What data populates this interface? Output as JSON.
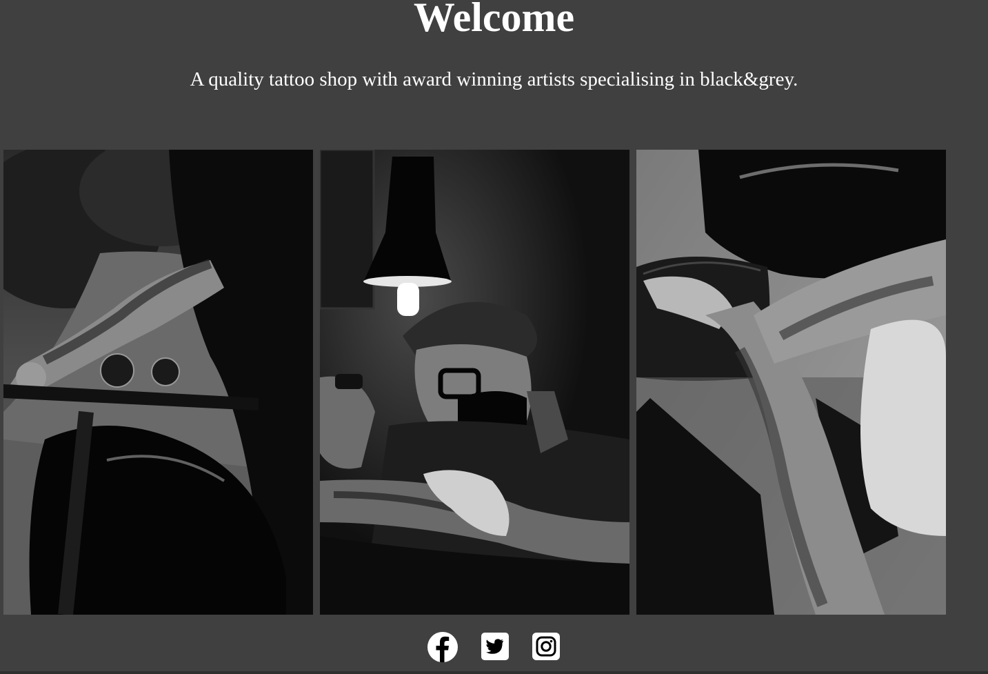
{
  "header": {
    "title": "Welcome",
    "tagline": "A quality tattoo shop with award winning artists specialising in black&grey."
  },
  "gallery": {
    "images": [
      {
        "subject": "tattooed arm on motorcycle handlebars"
      },
      {
        "subject": "masked tattoo artist working under a lamp"
      },
      {
        "subject": "tattooed arms resting on a motorcycle seat"
      }
    ]
  },
  "social": {
    "links": [
      {
        "name": "facebook",
        "icon": "facebook-icon"
      },
      {
        "name": "twitter",
        "icon": "twitter-icon"
      },
      {
        "name": "instagram",
        "icon": "instagram-icon"
      }
    ]
  },
  "colors": {
    "background": "#404040",
    "text": "#ffffff"
  }
}
